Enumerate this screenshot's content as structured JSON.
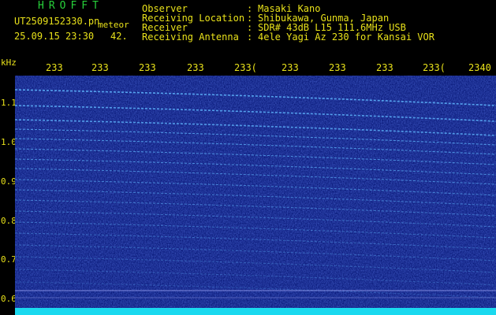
{
  "header": {
    "app_title": "HROFFT",
    "file_name": "UT2509152330.pn",
    "file_name_suffix": "meteor",
    "date_time": "25.09.15 23:30",
    "count": "42.",
    "info": [
      {
        "label": "Observer",
        "value": "Masaki Kano"
      },
      {
        "label": "Receiving Location",
        "value": "Shibukawa, Gunma, Japan"
      },
      {
        "label": "Receiver",
        "value": "SDR# 43dB L15 111.6MHz USB"
      },
      {
        "label": "Receiving Antenna",
        "value": "4ele Yagi Az 230 for Kansai VOR"
      }
    ]
  },
  "time_axis": {
    "ticks": [
      "233",
      "233",
      "233",
      "233",
      "233(",
      "233",
      "233",
      "233",
      "233(",
      "2340"
    ]
  },
  "freq_axis": {
    "unit": "kHz",
    "ticks": [
      "1.1",
      "1.0",
      "0.9",
      "0.8",
      "0.7",
      "0.6"
    ]
  },
  "colors": {
    "background": "#000000",
    "text": "#e8e11a",
    "title": "#27d13a",
    "spectrogram_base": "#0a1a7a",
    "signal_line": "#5fb8ff",
    "bottom_bar": "#1ad9ef"
  }
}
